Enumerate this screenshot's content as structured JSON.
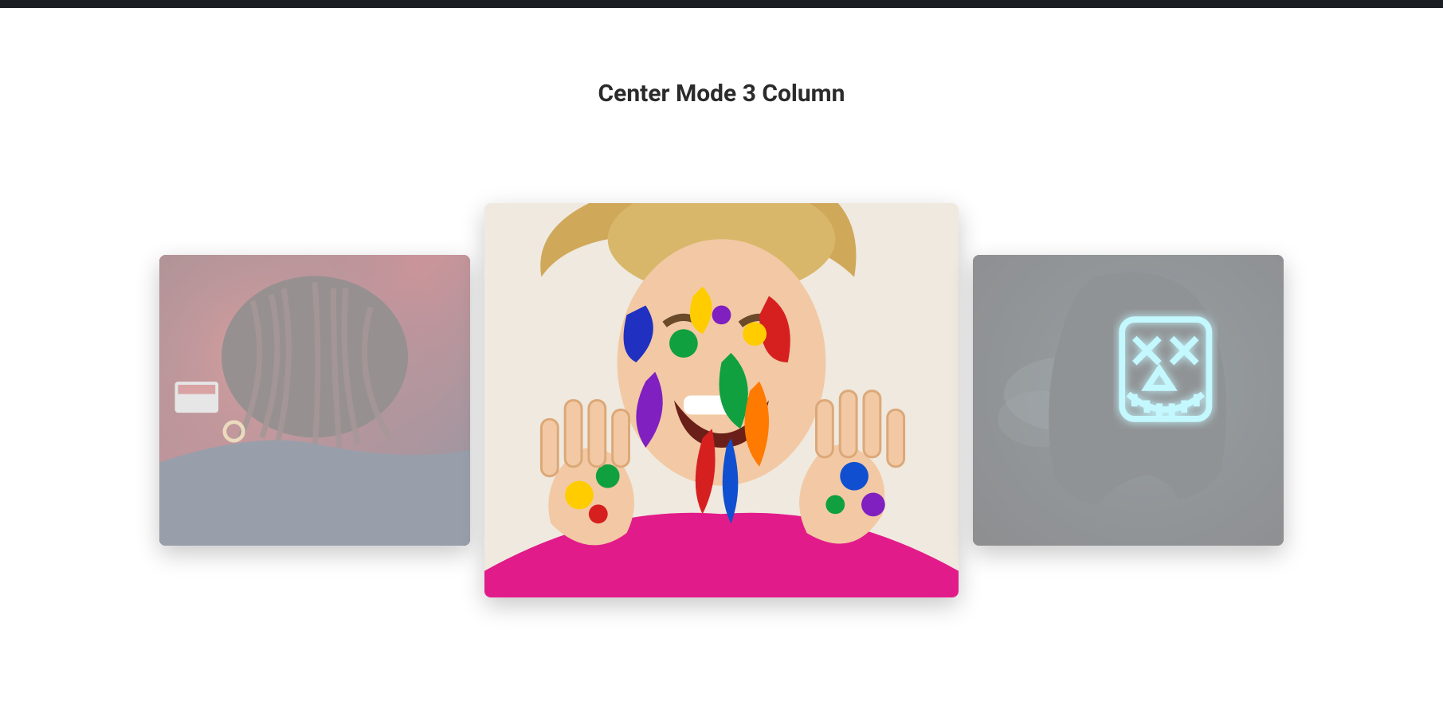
{
  "title": "Center Mode 3 Column",
  "slides": {
    "left": {
      "name": "carousel-slide-left",
      "interactable": true
    },
    "center": {
      "name": "carousel-slide-center",
      "interactable": true
    },
    "right": {
      "name": "carousel-slide-right",
      "interactable": true
    }
  }
}
